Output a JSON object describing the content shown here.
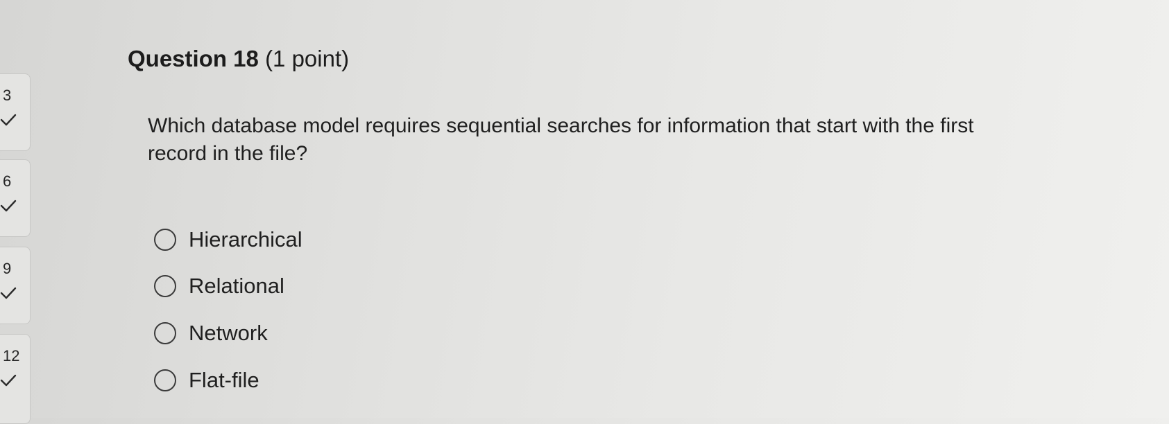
{
  "question": {
    "title": "Question 18",
    "points": "(1 point)",
    "text": "Which database model requires sequential searches for information that start with the first record in the file?",
    "options": [
      {
        "label": "Hierarchical"
      },
      {
        "label": "Relational"
      },
      {
        "label": "Network"
      },
      {
        "label": "Flat-file"
      }
    ]
  },
  "navigator": {
    "items": [
      {
        "number": "3",
        "status_icon": "check-icon"
      },
      {
        "number": "6",
        "status_icon": "check-icon"
      },
      {
        "number": "9",
        "status_icon": "check-icon"
      },
      {
        "number": "12",
        "status_icon": "check-icon"
      }
    ]
  },
  "colors": {
    "background": "#e4e4e2",
    "text": "#1e1e1e",
    "radio_border": "#3a3a3a"
  }
}
